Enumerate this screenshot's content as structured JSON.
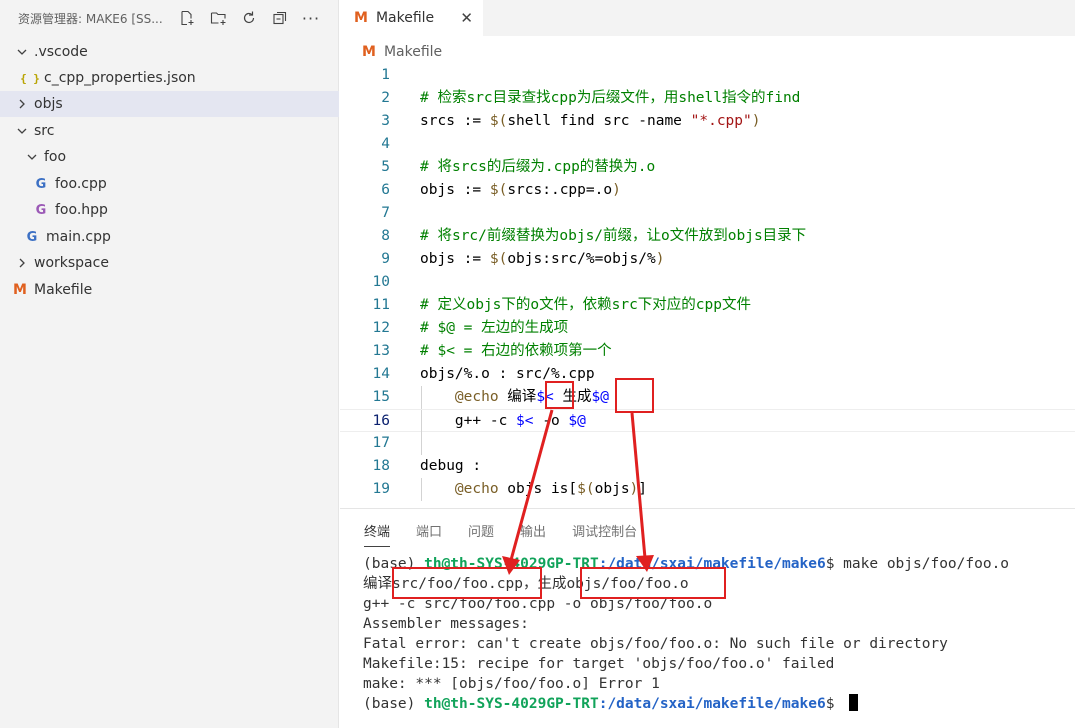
{
  "sidebar": {
    "title": "资源管理器: MAKE6 [SS...",
    "items": [
      {
        "label": ".vscode",
        "chevron": "v",
        "kind": "folder"
      },
      {
        "label": "c_cpp_properties.json",
        "icon": "{ }",
        "kind": "json"
      },
      {
        "label": "objs",
        "chevron": ">",
        "kind": "folder"
      },
      {
        "label": "src",
        "chevron": "v",
        "kind": "folder"
      },
      {
        "label": "foo",
        "chevron": "v",
        "kind": "folder"
      },
      {
        "label": "foo.cpp",
        "icon": "G",
        "kind": "cpp"
      },
      {
        "label": "foo.hpp",
        "icon": "G",
        "kind": "hpp"
      },
      {
        "label": "main.cpp",
        "icon": "G",
        "kind": "cpp"
      },
      {
        "label": "workspace",
        "chevron": ">",
        "kind": "folder"
      },
      {
        "label": "Makefile",
        "icon": "M",
        "kind": "makefile"
      }
    ]
  },
  "tab": {
    "label": "Makefile",
    "icon": "M",
    "close": "✕"
  },
  "breadcrumb": {
    "label": "Makefile",
    "icon": "M"
  },
  "editor": {
    "line_numbers": [
      "1",
      "2",
      "3",
      "4",
      "5",
      "6",
      "7",
      "8",
      "9",
      "10",
      "11",
      "12",
      "13",
      "14",
      "15",
      "16",
      "17",
      "18",
      "19"
    ],
    "lines": {
      "l2": "# 检索src目录查找cpp为后缀文件，用shell指令的find",
      "l3a": "srcs := ",
      "l3b": "$(",
      "l3c": "shell find src -name ",
      "l3d": "\"*.cpp\"",
      "l3e": ")",
      "l5": "# 将srcs的后缀为.cpp的替换为.o",
      "l6a": "objs := ",
      "l6b": "$(",
      "l6c": "srcs:.cpp=.o",
      "l6d": ")",
      "l8": "# 将src/前缀替换为objs/前缀，让o文件放到objs目录下",
      "l9a": "objs := ",
      "l9b": "$(",
      "l9c": "objs:src/%=objs/%",
      "l9d": ")",
      "l11": "# 定义objs下的o文件，依赖src下对应的cpp文件",
      "l12": "# $@ = 左边的生成项",
      "l13": "# $< = 右边的依赖项第一个",
      "l14": "objs/%.o : src/%.cpp",
      "l15a": "    ",
      "l15b": "@echo",
      "l15c": " 编译",
      "l15d": "$<",
      "l15e": " 生成",
      "l15f": "$@",
      "l16a": "    g++ -c ",
      "l16b": "$<",
      "l16c": " -o ",
      "l16d": "$@",
      "l18": "debug :",
      "l19a": "    ",
      "l19b": "@echo",
      "l19c": " objs is[",
      "l19d": "$(",
      "l19e": "objs",
      "l19f": ")",
      "l19g": "]"
    }
  },
  "panel": {
    "tabs": [
      "终端",
      "端口",
      "问题",
      "输出",
      "调试控制台"
    ],
    "terminal": {
      "prompt_env": "(base) ",
      "prompt_user": "th@th-SYS-4029GP-TRT",
      "prompt_path": ":/data/sxai/makefile/make6",
      "prompt_end": "$ ",
      "cmd": "make objs/foo/foo.o",
      "out1": "编译src/foo/foo.cpp，生成objs/foo/foo.o",
      "out2": "g++ -c src/foo/foo.cpp -o objs/foo/foo.o",
      "out3": "Assembler messages:",
      "out4": "Fatal error: can't create objs/foo/foo.o: No such file or directory",
      "out5": "Makefile:15: recipe for target 'objs/foo/foo.o' failed",
      "out6": "make: *** [objs/foo/foo.o] Error 1"
    }
  },
  "colors": {
    "annotation": "#e02020",
    "accent": "#e0601f"
  }
}
